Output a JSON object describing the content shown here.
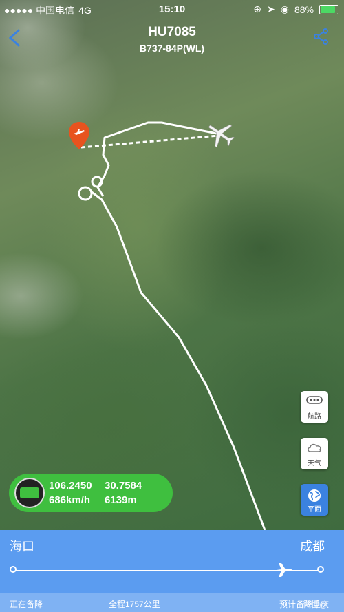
{
  "status_bar": {
    "carrier": "●●●●● 中国电信",
    "network": "4G",
    "time": "15:10",
    "battery": "88%",
    "battery_level": 0.88
  },
  "header": {
    "flight_number": "HU7085",
    "aircraft": "B737-84P(WL)"
  },
  "side_buttons": {
    "route_label": "航路",
    "weather_label": "天气",
    "plane_label": "平面"
  },
  "info": {
    "longitude": "106.2450",
    "latitude": "30.7584",
    "speed": "686km/h",
    "altitude": "6139m"
  },
  "route": {
    "origin": "海口",
    "destination": "成都"
  },
  "footer": {
    "status": "正在备降",
    "distance": "全程1757公里",
    "eta": "预计备降重庆"
  },
  "watermark": "微博@",
  "colors": {
    "accent": "#5b9cf0",
    "pill": "#3fbf3f",
    "pin": "#e8531f"
  }
}
